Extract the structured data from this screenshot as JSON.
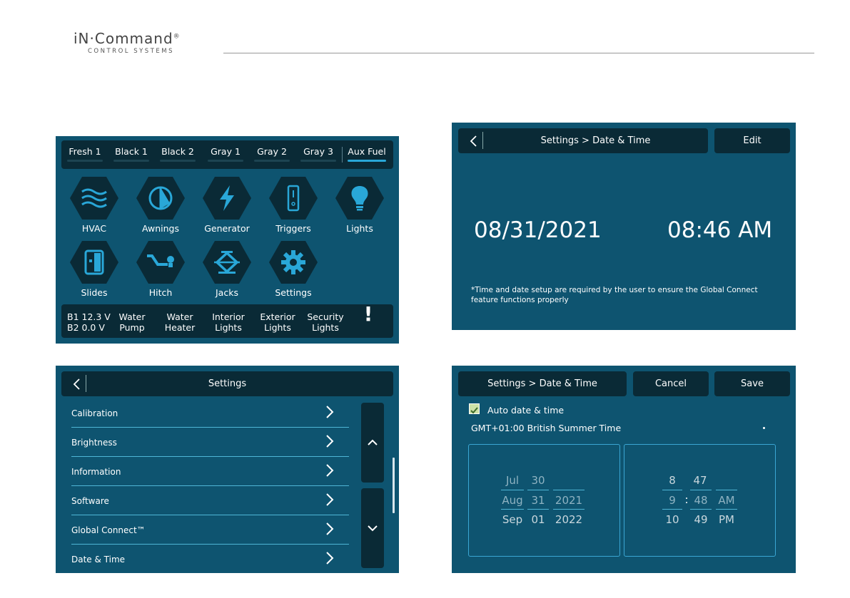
{
  "header": {
    "brand": "iN·Command",
    "reg": "®",
    "tagline": "CONTROL SYSTEMS"
  },
  "home_screen": {
    "tanks": [
      {
        "label": "Fresh 1",
        "active": false
      },
      {
        "label": "Black 1",
        "active": false
      },
      {
        "label": "Black 2",
        "active": false
      },
      {
        "label": "Gray 1",
        "active": false
      },
      {
        "label": "Gray 2",
        "active": false
      },
      {
        "label": "Gray 3",
        "active": false
      },
      {
        "label": "Aux Fuel",
        "active": true
      }
    ],
    "tiles": [
      {
        "label": "HVAC",
        "icon": "hvac-waves-icon"
      },
      {
        "label": "Awnings",
        "icon": "awning-icon"
      },
      {
        "label": "Generator",
        "icon": "lightning-bolt-icon"
      },
      {
        "label": "Triggers",
        "icon": "switch-icon"
      },
      {
        "label": "Lights",
        "icon": "light-bulb-icon"
      },
      {
        "label": "Slides",
        "icon": "slide-out-icon"
      },
      {
        "label": "Hitch",
        "icon": "hitch-icon"
      },
      {
        "label": "Jacks",
        "icon": "jack-icon"
      },
      {
        "label": "Settings",
        "icon": "gear-icon"
      }
    ],
    "battery": {
      "b1": "B1  12.3 V",
      "b2": "B2   0.0 V"
    },
    "quick": [
      {
        "l1": "Water",
        "l2": "Pump"
      },
      {
        "l1": "Water",
        "l2": "Heater"
      },
      {
        "l1": "Interior",
        "l2": "Lights"
      },
      {
        "l1": "Exterior",
        "l2": "Lights"
      },
      {
        "l1": "Security",
        "l2": "Lights"
      }
    ],
    "alert": "!"
  },
  "date_view": {
    "title": "Settings > Date & Time",
    "edit": "Edit",
    "date": "08/31/2021",
    "time": "08:46 AM",
    "note": "*Time and date setup are required by the user to ensure the Global Connect feature functions properly"
  },
  "settings_list": {
    "title": "Settings",
    "items": [
      "Calibration",
      "Brightness",
      "Information",
      "Software",
      "Global Connect™",
      "Date & Time"
    ]
  },
  "date_edit": {
    "title": "Settings > Date & Time",
    "cancel": "Cancel",
    "save": "Save",
    "auto_label": "Auto date & time",
    "auto_checked": true,
    "timezone": "GMT+01:00 British Summer Time",
    "date_picker": {
      "month": [
        "Jul",
        "Aug",
        "Sep"
      ],
      "day": [
        "30",
        "31",
        "01"
      ],
      "year": [
        "",
        "2021",
        "2022"
      ]
    },
    "time_picker": {
      "hour": [
        "8",
        "9",
        "10"
      ],
      "minute": [
        "47",
        "48",
        "49"
      ],
      "ampm": [
        "",
        "AM",
        "PM"
      ],
      "colon": ":"
    }
  }
}
